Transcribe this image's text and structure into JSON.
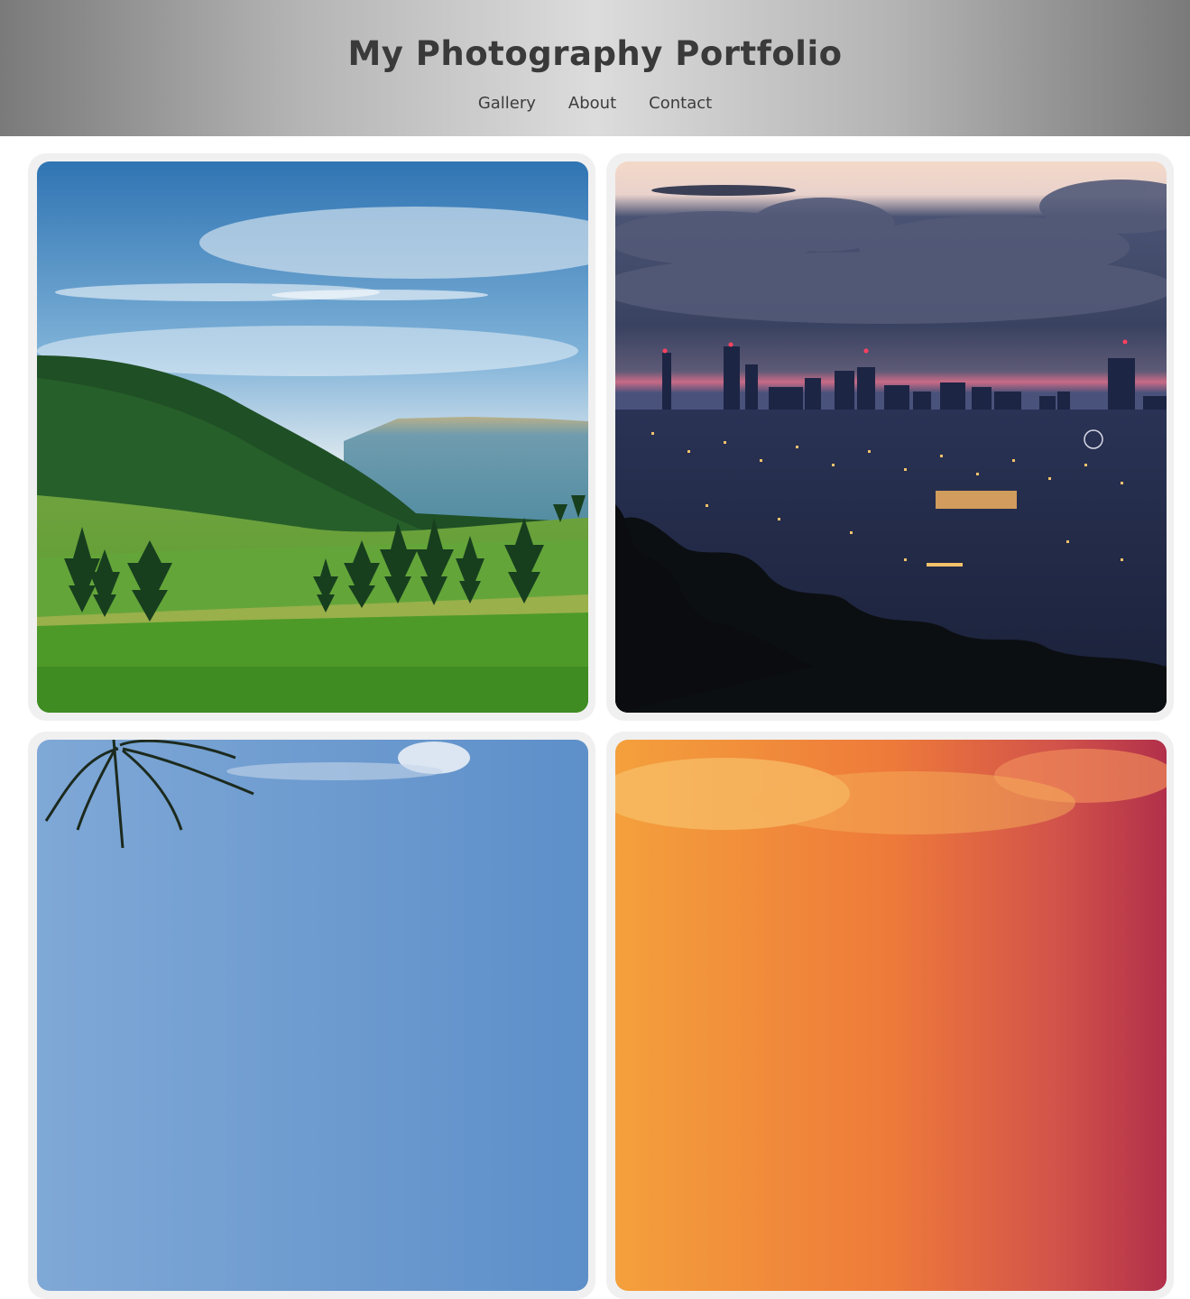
{
  "site": {
    "title": "My Photography Portfolio"
  },
  "nav": {
    "items": [
      {
        "label": "Gallery"
      },
      {
        "label": "About"
      },
      {
        "label": "Contact"
      }
    ]
  },
  "gallery": {
    "photos": [
      {
        "subject": "mountain-meadow-landscape"
      },
      {
        "subject": "city-skyline-at-dusk"
      },
      {
        "subject": "palm-tree-blue-sky"
      },
      {
        "subject": "orange-sunset-sky"
      }
    ]
  }
}
